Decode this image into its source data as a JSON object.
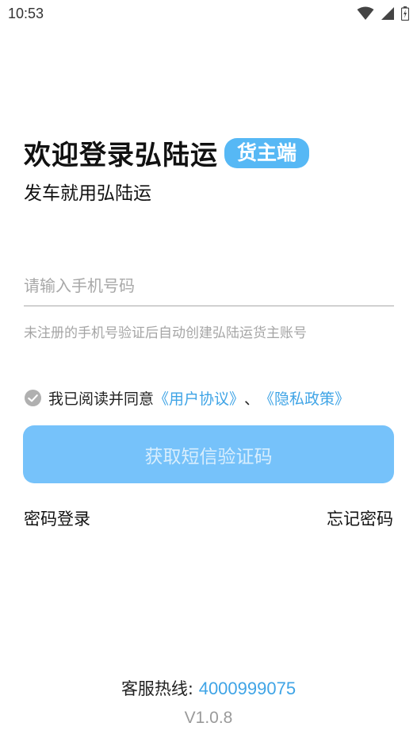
{
  "status_bar": {
    "time": "10:53",
    "icons": [
      "wifi-icon",
      "signal-icon",
      "battery-icon"
    ]
  },
  "header": {
    "title": "欢迎登录弘陆运",
    "badge": "货主端",
    "subtitle": "发车就用弘陆运"
  },
  "form": {
    "phone_placeholder": "请输入手机号码",
    "phone_value": "",
    "hint": "未注册的手机号验证后自动创建弘陆运货主账号"
  },
  "agreement": {
    "prefix": "我已阅读并同意",
    "user_agreement": "《用户协议》",
    "separator": "、",
    "privacy_policy": "《隐私政策》",
    "checked": true
  },
  "buttons": {
    "sms_code": "获取短信验证码",
    "password_login": "密码登录",
    "forgot_password": "忘记密码"
  },
  "footer": {
    "hotline_label": "客服热线:",
    "hotline_number": "4000999075",
    "version": "V1.0.8"
  },
  "colors": {
    "accent": "#56b8f5",
    "button": "#76c2fa",
    "link": "#3fa4e6"
  }
}
